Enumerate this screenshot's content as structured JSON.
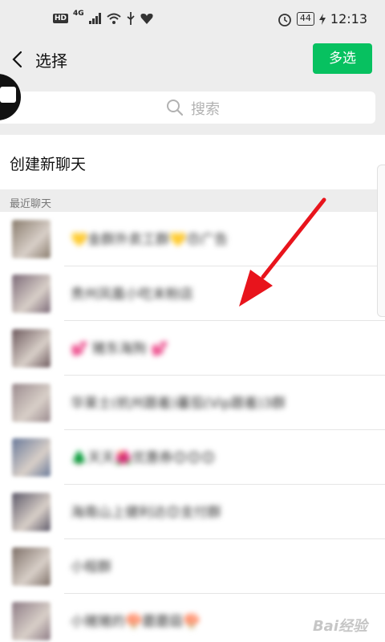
{
  "status_bar": {
    "network": "4G",
    "battery": "44",
    "time": "12:13"
  },
  "header": {
    "title": "选择",
    "multi_select_label": "多选"
  },
  "search": {
    "placeholder": "搜索"
  },
  "new_chat": {
    "label": "创建新聊天"
  },
  "section": {
    "recent_label": "最近聊天"
  },
  "chats": [
    {
      "name": "💛金群外卖工群💛😠广告",
      "avatar_color": "#8a7d6e"
    },
    {
      "name": "贵州凤凰小吃末粉店",
      "avatar_color": "#7c6a78"
    },
    {
      "name": "💕 猪东海狗 💕",
      "avatar_color": "#6e5a5e"
    },
    {
      "name": "华莱士(杭州跟着)蕃茄(Vip跟着)3群",
      "avatar_color": "#9a8a8e"
    },
    {
      "name": "🌲天天🌺优惠券😊😊😊",
      "avatar_color": "#6a7a9a"
    },
    {
      "name": "海南山上健利达😊支付群",
      "avatar_color": "#5e5a6a"
    },
    {
      "name": "小程群",
      "avatar_color": "#7e7068"
    },
    {
      "name": "小猪猪的🍄蘑蘑菇🍄",
      "avatar_color": "#8e7c86"
    }
  ],
  "colors": {
    "accent": "#07c160",
    "arrow": "#e8141c"
  },
  "watermark": "Bai经验"
}
